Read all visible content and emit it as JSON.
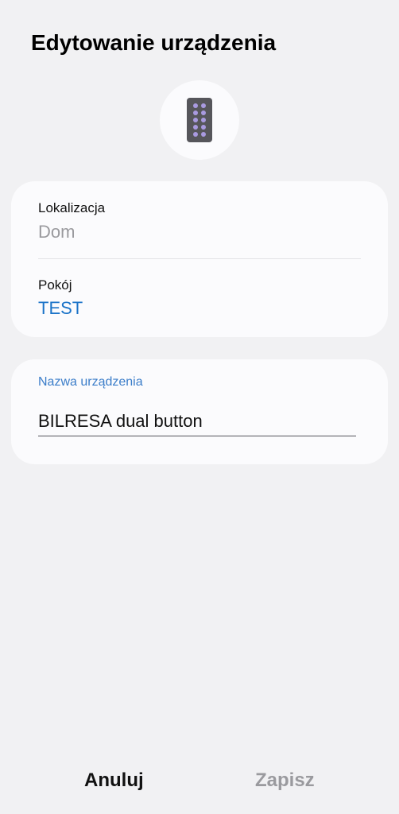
{
  "header": {
    "title": "Edytowanie urządzenia"
  },
  "device_icon": {
    "icon": "remote-control-icon",
    "body_color": "#56565b",
    "button_color": "#a99ae0"
  },
  "location_card": {
    "location_label": "Lokalizacja",
    "location_value": "Dom",
    "room_label": "Pokój",
    "room_value": "TEST"
  },
  "name_card": {
    "label": "Nazwa urządzenia",
    "value": "BILRESA dual button"
  },
  "footer": {
    "cancel_label": "Anuluj",
    "save_label": "Zapisz"
  },
  "colors": {
    "background": "#f1f1f3",
    "card": "#fbfbfd",
    "accent_blue": "#1a73c8",
    "label_blue": "#3b7dc9",
    "disabled_gray": "#9a9a9e"
  }
}
